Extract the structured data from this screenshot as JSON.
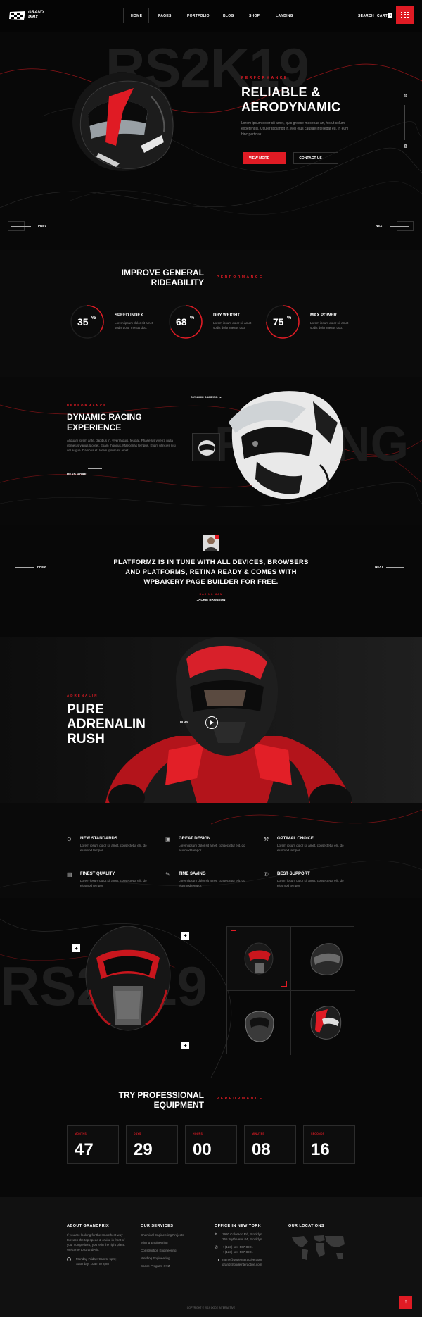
{
  "brand": {
    "line1": "GRAND",
    "line2": "PRIX"
  },
  "nav": {
    "items": [
      "HOME",
      "PAGES",
      "PORTFOLIO",
      "BLOG",
      "SHOP",
      "LANDING"
    ],
    "search": "SEARCH",
    "cart": "CART",
    "cart_count": "0"
  },
  "hero": {
    "watermark": "RS2K19",
    "eyebrow": "PERFORMANCE",
    "title_line1": "RELIABLE &",
    "title_line2": "AERODYNAMIC",
    "body": "Lorem ipsum dolor sit amet, quis greece mecenas an, his ut solum expetendis. Usu erat blandit in. Mei eius causae intellegat eu, in eum hinc pertinax.",
    "btn_primary": "VIEW MORE",
    "btn_secondary": "CONTACT US",
    "counter_a": "02",
    "counter_b": "03",
    "prev": "PREV",
    "next": "NEXT"
  },
  "rideability": {
    "title_line1": "IMPROVE GENERAL",
    "title_line2": "RIDEABILITY",
    "tag": "PERFORMANCE",
    "stats": [
      {
        "value": "35",
        "unit": "%",
        "percent": 35,
        "title": "SPEED INDEX",
        "desc_line1": "Lorem ipsum dolor sit amet",
        "desc_line2": "sodis dolor mesus duo."
      },
      {
        "value": "68",
        "unit": "%",
        "percent": 68,
        "title": "DRY WEIGHT",
        "desc_line1": "Lorem ipsum dolor sit amet",
        "desc_line2": "sodis dolor mesus duo."
      },
      {
        "value": "75",
        "unit": "%",
        "percent": 75,
        "title": "MAX POWER",
        "desc_line1": "Lorem ipsum dolor sit amet",
        "desc_line2": "sodis dolor mesus duo."
      }
    ]
  },
  "racing": {
    "eyebrow": "PERFORMANCE",
    "title_line1": "DYNAMIC RACING",
    "title_line2": "EXPERIENCE",
    "body": "Aliquam lorem ante, dapibus in, viverra quis, feugiat. Phasellus viverra nulla ut metus varius laoreet. Etiam rhoncus. Maecenas tempus. Etiam ultricies nisi vel augue. Dapibus et, lorem ipsum sit amet.",
    "read_more": "READ MORE",
    "video_label": "DYNAMIC DAMPING",
    "watermark": "RACING"
  },
  "testimonial": {
    "quote_line1": "PLATFORMZ IS IN TUNE WITH ALL DEVICES, BROWSERS",
    "quote_line2": "AND PLATFORMS, RETINA READY & COMES WITH",
    "quote_line3": "WPBAKERY PAGE BUILDER FOR FREE.",
    "role": "RACING MAN",
    "author": "JACKIE BRONSON",
    "prev": "PREV",
    "next": "NEXT"
  },
  "adrenalin": {
    "eyebrow": "ADRENALIN",
    "line1": "PURE",
    "line2": "ADRENALIN",
    "line3": "RUSH",
    "play": "PLAY"
  },
  "features": [
    {
      "icon": "badge-icon",
      "glyph": "⊙",
      "title": "NEW STANDARDS",
      "desc": "Lorem ipsum dolor sit amet, consectetur elit, do eiusmod tempor."
    },
    {
      "icon": "calendar-icon",
      "glyph": "▣",
      "title": "GREAT DESIGN",
      "desc": "Lorem ipsum dolor sit amet, consectetur elit, do eiusmod tempor."
    },
    {
      "icon": "wrench-icon",
      "glyph": "⚒",
      "title": "OPTIMAL CHOICE",
      "desc": "Lorem ipsum dolor sit amet, consectetur elit, do eiusmod tempor."
    },
    {
      "icon": "clipboard-icon",
      "glyph": "▤",
      "title": "FINEST QUALITY",
      "desc": "Lorem ipsum dolor sit amet, consectetur elit, do eiusmod tempor."
    },
    {
      "icon": "pen-icon",
      "glyph": "✎",
      "title": "TIME SAVING",
      "desc": "Lorem ipsum dolor sit amet, consectetur elit, do eiusmod tempor."
    },
    {
      "icon": "support-icon",
      "glyph": "✆",
      "title": "BEST SUPPORT",
      "desc": "Lorem ipsum dolor sit amet, consectetur elit, do eiusmod tempor."
    }
  ],
  "product": {
    "watermark": "RS2K19",
    "plus": "+"
  },
  "equipment": {
    "title_line1": "TRY PROFESSIONAL",
    "title_line2": "EQUIPMENT",
    "tag": "PERFORMANCE",
    "countdown": [
      {
        "label": "MONTHS",
        "value": "47"
      },
      {
        "label": "DAYS",
        "value": "29"
      },
      {
        "label": "HOURS",
        "value": "00"
      },
      {
        "label": "MINUTES",
        "value": "08"
      },
      {
        "label": "SECONDS",
        "value": "16"
      }
    ]
  },
  "footer": {
    "about": {
      "title": "ABOUT GRANDPRIX",
      "line1": "If you are looking for the smoothest way",
      "line2": "to reach the top speed & cruise in front of",
      "line3": "your competitors, you're in the right place.",
      "line4": "Welcome to GrandPrix.",
      "hours1": "Monday-Friday: 9am to 5pm;",
      "hours2": "Saturday: 10am to 2pm"
    },
    "services": {
      "title": "OUR SERVICES",
      "items": [
        "Chemical Engineering Projects",
        "Mining Engineering",
        "Construction Engineering",
        "Welding Engineering",
        "Space Program XYZ"
      ]
    },
    "office": {
      "title": "OFFICE IN NEW YORK",
      "address1": "1980 Colorado Rd, Brooklyn",
      "address2": "265 Wythe Ave #4, Brooklyn",
      "phone1": "+ (123) 124-567-8901",
      "phone2": "+ (123) 124-567-8901",
      "email1": "name@qodeinteractive.com",
      "email2": "grand@qodeinteractive.com"
    },
    "locations": {
      "title": "OUR LOCATIONS"
    },
    "copyright": "COPYRIGHT © 2019 QODE INTERACTIVE"
  },
  "colors": {
    "accent": "#e01b24",
    "bg": "#0a0a0a"
  }
}
